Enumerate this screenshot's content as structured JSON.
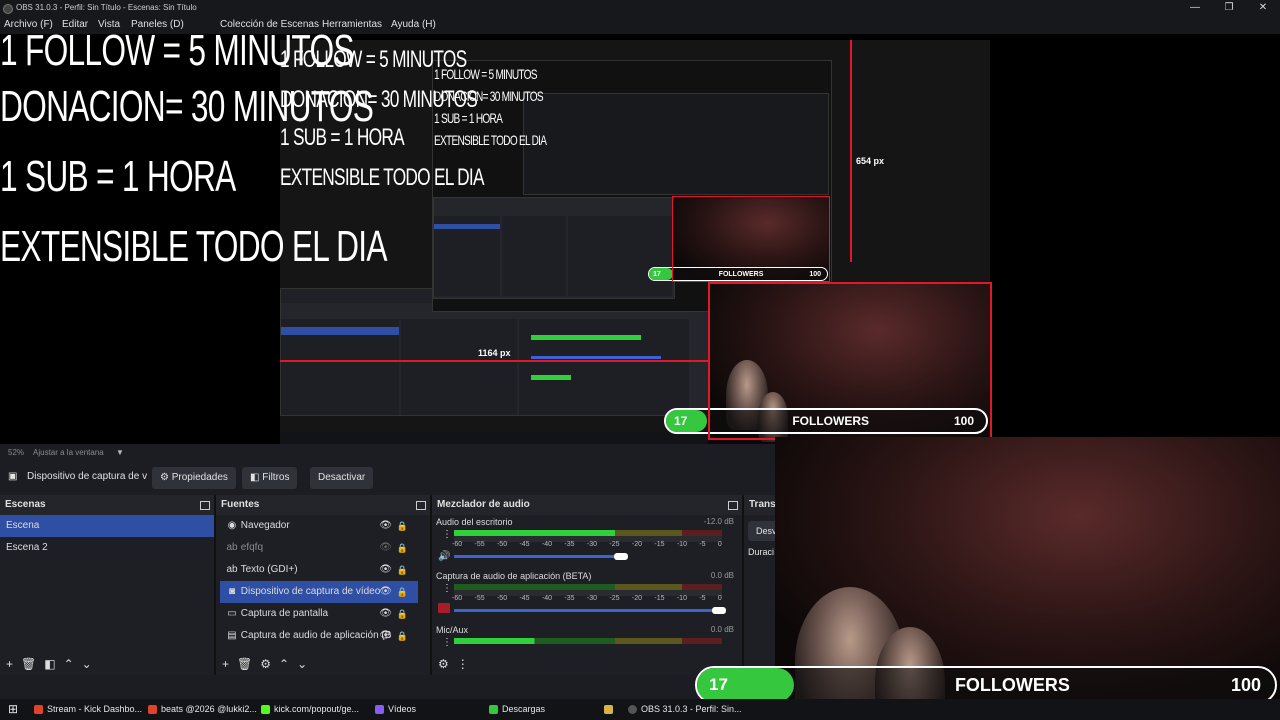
{
  "window": {
    "title": "OBS 31.0.3 - Perfil: Sin Título - Escenas: Sin Título",
    "controls": [
      "—",
      "❐",
      "✕"
    ]
  },
  "menu": [
    "Archivo (F)",
    "Editar",
    "Vista",
    "Paneles (D)",
    "Colección de Escenas",
    "Herramientas",
    "Ayuda (H)"
  ],
  "overlay": {
    "lines": [
      "1 FOLLOW = 5 MINUTOS",
      "DONACION= 30 MINUTOS",
      "1 SUB = 1 HORA",
      "EXTENSIBLE TODO EL DIA"
    ]
  },
  "measure": {
    "height_label": "654 px",
    "width_label": "1164 px"
  },
  "followers_widget": {
    "count": "17",
    "label": "FOLLOWERS",
    "goal": "100"
  },
  "zoom": {
    "percent": "52%",
    "mode": "Ajustar a la ventana"
  },
  "source_toolbar": {
    "source_name": "Dispositivo de captura de v",
    "properties": "Propiedades",
    "filters": "Filtros",
    "deactivate": "Desactivar"
  },
  "scenes": {
    "title": "Escenas",
    "items": [
      "Escena",
      "Escena 2"
    ]
  },
  "sources": {
    "title": "Fuentes",
    "items": [
      "Navegador",
      "efqfq",
      "Texto (GDI+)",
      "Dispositivo de captura de vídeo",
      "Captura de pantalla",
      "Captura de audio de aplicación (B"
    ]
  },
  "mixer": {
    "title": "Mezclador de audio",
    "ticks": [
      "-60",
      "-55",
      "-50",
      "-45",
      "-40",
      "-35",
      "-30",
      "-25",
      "-20",
      "-15",
      "-10",
      "-5",
      "0"
    ],
    "channels": [
      {
        "name": "Audio del escritorio",
        "db": "-12.0 dB",
        "level": 0.6,
        "volume": 0.6
      },
      {
        "name": "Captura de audio de aplicación (BETA)",
        "db": "0.0 dB",
        "level": 0.0,
        "volume": 0.97
      },
      {
        "name": "Mic/Aux",
        "db": "0.0 dB",
        "level": 0.3,
        "volume": 0.97
      }
    ]
  },
  "transitions": {
    "title": "Trans",
    "fade": "Desv",
    "duration": "Duraci"
  },
  "taskbar": [
    {
      "label": "Stream - Kick Dashbo...",
      "color": "#e0422c"
    },
    {
      "label": "beats @2026 @lukki2...",
      "color": "#e0422c"
    },
    {
      "label": "kick.com/popout/ge...",
      "color": "#53fc18"
    },
    {
      "label": "Vídeos",
      "color": "#8a5cf5"
    },
    {
      "label": "Descargas",
      "color": "#35c73e"
    },
    {
      "label": "OBS 31.0.3 - Perfil: Sin...",
      "color": "#555555"
    }
  ],
  "colors": {
    "accent": "#2f4fa5",
    "guide_red": "#e0192a",
    "followers_green": "#35c73e"
  }
}
